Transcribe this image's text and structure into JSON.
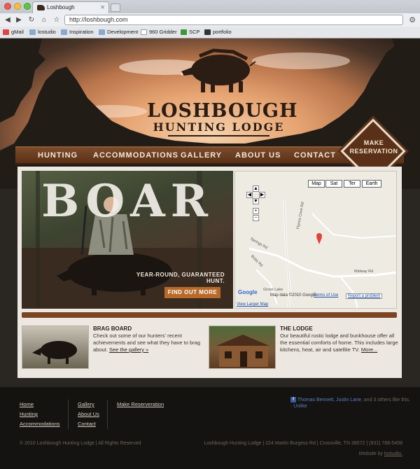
{
  "browser": {
    "tab_title": "Loshbough",
    "url": "http://loshbough.com",
    "bookmarks": [
      "gMail",
      "lostudio",
      "Inspiration",
      "Development",
      "960 Gridder",
      "SCP",
      "portfolio"
    ]
  },
  "logo": {
    "name": "LOSHBOUGH",
    "subtitle": "HUNTING LODGE"
  },
  "nav": {
    "items": [
      "HUNTING",
      "ACCOMMODATIONS",
      "GALLERY",
      "ABOUT US",
      "CONTACT"
    ],
    "reserve_line1": "MAKE",
    "reserve_line2": "RESERVATION"
  },
  "hero": {
    "word": "BOAR",
    "tagline": "YEAR-ROUND, GUARANTEED HUNT.",
    "button": "FIND OUT MORE"
  },
  "map": {
    "types": [
      "Map",
      "Sat",
      "Ter",
      "Earth"
    ],
    "credit": "Map data ©2010 Google -",
    "terms": "Terms of Use",
    "report": "Report a problem",
    "larger": "View Larger Map",
    "roads": [
      "Flynns Cove Rd",
      "Springs Rd",
      "Bobs Rd",
      "Midway Rd",
      "Gross Lake"
    ],
    "powered": "Google"
  },
  "brag": {
    "title": "BRAG BOARD",
    "text": "Check out some of our hunters' recent achievements and see what they have to brag about.",
    "link": "See the gallery »"
  },
  "lodge": {
    "title": "THE LODGE",
    "text": "Our beautiful rustic lodge and bunkhouse offer all the essential comforts of home. This includes large kitchens, heat, air and satellite TV.",
    "link": "More..."
  },
  "footer": {
    "col1": [
      "Home",
      "Hunting",
      "Accommodations"
    ],
    "col2": [
      "Gallery",
      "About Us",
      "Contact"
    ],
    "col3": [
      "Make Reserveration"
    ],
    "fb_names": "Thomas Bennett, Justin Lane,",
    "fb_rest": "and 3 others like this. ·",
    "fb_unlike": "Unlike",
    "copyright": "© 2010 Loshbough Hunting Lodge | All Rights Reserved",
    "address": "Loshbough Hunting Lodge | 224 Martin Burgess Rd | Crossville, TN 38572 | (931) 788-5408",
    "madeby_prefix": "Website by",
    "madeby_link": "lostudio."
  },
  "colors": {
    "accent": "#b86a2a",
    "nav": "#5a3118",
    "panel": "#ece8e1"
  }
}
